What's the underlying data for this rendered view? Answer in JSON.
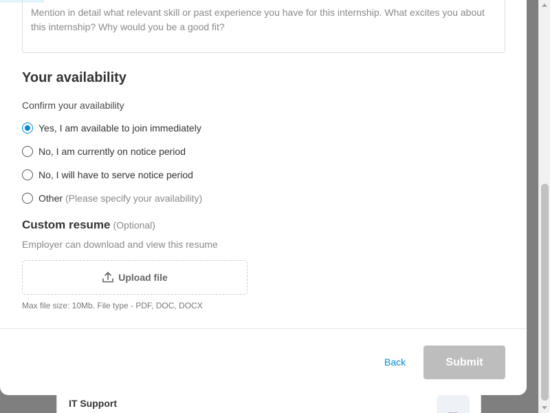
{
  "background_page": {
    "card_title": "IT Support"
  },
  "form": {
    "cover_letter_placeholder": "Mention in detail what relevant skill or past experience you have for this internship. What excites you about this internship? Why would you be a good fit?",
    "availability": {
      "title": "Your availability",
      "confirm_label": "Confirm your availability",
      "options": [
        {
          "label": "Yes, I am available to join immediately",
          "hint": "",
          "selected": true
        },
        {
          "label": "No, I am currently on notice period",
          "hint": "",
          "selected": false
        },
        {
          "label": "No, I will have to serve notice period",
          "hint": "",
          "selected": false
        },
        {
          "label": "Other",
          "hint": "(Please specify your availability)",
          "selected": false
        }
      ]
    },
    "resume": {
      "title": "Custom resume",
      "optional_label": "(Optional)",
      "description": "Employer can download and view this resume",
      "upload_label": "Upload file",
      "upload_note": "Max file size: 10Mb. File type - PDF, DOC, DOCX"
    }
  },
  "footer": {
    "back_label": "Back",
    "submit_label": "Submit"
  },
  "colors": {
    "accent": "#008bdc",
    "submit_disabled": "#bdbdbd"
  }
}
